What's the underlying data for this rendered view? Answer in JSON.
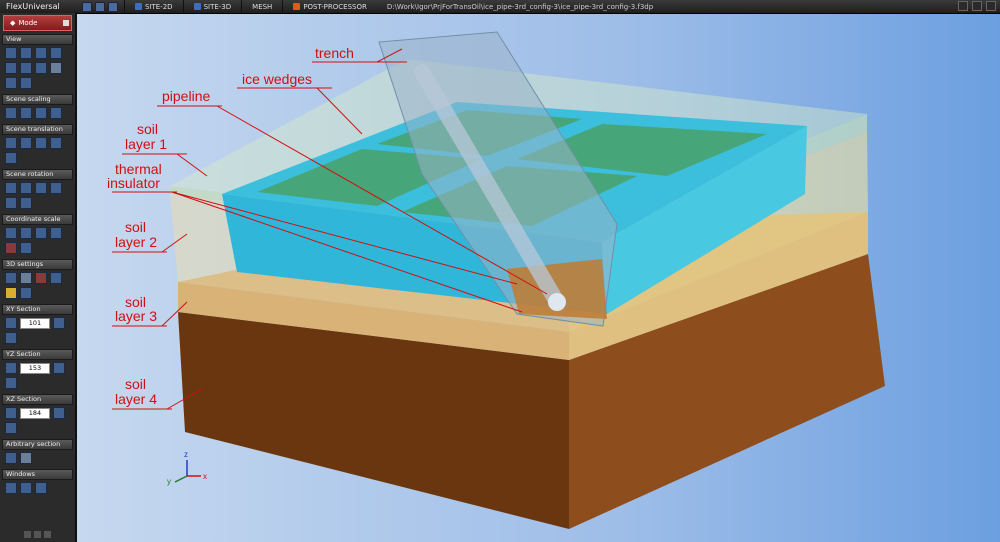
{
  "app": {
    "title": "FlexUniversal"
  },
  "tabs": [
    {
      "label": "SITE-2D",
      "color": "#3b6cc7"
    },
    {
      "label": "SITE-3D",
      "color": "#3b6cc7"
    },
    {
      "label": "MESH",
      "color": "#777777"
    },
    {
      "label": "POST-PROCESSOR",
      "color": "#e05a20"
    }
  ],
  "file_path": "D:\\Work\\Igor\\PrjForTransOil\\ice_pipe-3rd_config-3\\ice_pipe-3rd_config-3.f3dp",
  "mode_label": "Mode",
  "sections": {
    "view": "View",
    "scene_scaling": "Scene scaling",
    "scene_translation": "Scene translation",
    "scene_rotation": "Scene rotation",
    "coordinate_scale": "Coordinate scale",
    "settings_3d": "3D settings",
    "xy_section": "XY Section",
    "yz_section": "YZ Section",
    "xz_section": "XZ Section",
    "arbitrary_section": "Arbitrary section",
    "windows": "Windows"
  },
  "section_values": {
    "xy": "101",
    "yz": "153",
    "xz": "184"
  },
  "annotations": {
    "trench": "trench",
    "ice_wedges": "ice wedges",
    "pipeline": "pipeline",
    "soil_layer_1": [
      "soil",
      "layer 1"
    ],
    "thermal_insulator": [
      "thermal",
      "insulator"
    ],
    "soil_layer_2": [
      "soil",
      "layer 2"
    ],
    "soil_layer_3": [
      "soil",
      "layer 3"
    ],
    "soil_layer_4": [
      "soil",
      "layer 4"
    ]
  },
  "axes": {
    "x": "x",
    "y": "y",
    "z": "z"
  },
  "colors": {
    "soil_layer_1": "#c8e0b0",
    "soil_layer_2": "#e7d296",
    "soil_layer_3": "#d0a260",
    "soil_layer_4": "#7b4216",
    "ice_wedges": "#2fb6d8",
    "annotation": "#d01010"
  }
}
